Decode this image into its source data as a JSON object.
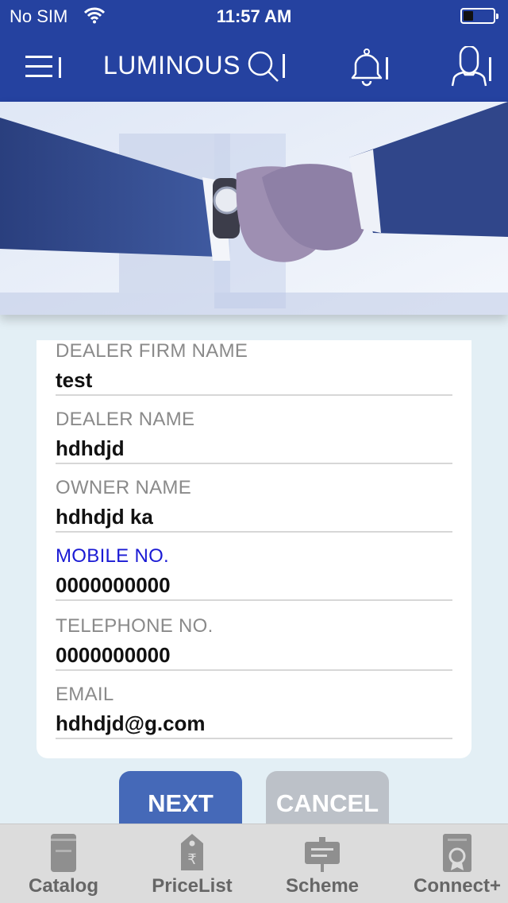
{
  "status_bar": {
    "carrier": "No SIM",
    "time": "11:57 AM"
  },
  "nav": {
    "brand": "LUMINOUS",
    "icons": [
      "menu-icon",
      "search-icon",
      "bell-icon",
      "user-icon"
    ]
  },
  "banner": {
    "image": "handshake-photo"
  },
  "form": {
    "fields": [
      {
        "label": "DEALER FIRM NAME",
        "value": "test"
      },
      {
        "label": "DEALER NAME",
        "value": "hdhdjd"
      },
      {
        "label": "OWNER NAME",
        "value": "hdhdjd ka"
      },
      {
        "label": "MOBILE NO.",
        "value": "0000000000",
        "active": true
      },
      {
        "label": "TELEPHONE NO.",
        "value": "0000000000"
      },
      {
        "label": "EMAIL",
        "value": "hdhdjd@g.com"
      }
    ]
  },
  "buttons": {
    "next": "NEXT",
    "cancel": "CANCEL"
  },
  "tabs": [
    {
      "label": "Catalog",
      "icon": "catalog-icon"
    },
    {
      "label": "PriceList",
      "icon": "price-tag-icon"
    },
    {
      "label": "Scheme",
      "icon": "scheme-board-icon"
    },
    {
      "label": "Connect+",
      "icon": "certificate-icon"
    }
  ],
  "colors": {
    "header": "#2542a0",
    "background": "#e3eff5",
    "active_label": "#1a1ad4",
    "next_button": "#4569b8",
    "cancel_button": "#bcc1c8"
  }
}
